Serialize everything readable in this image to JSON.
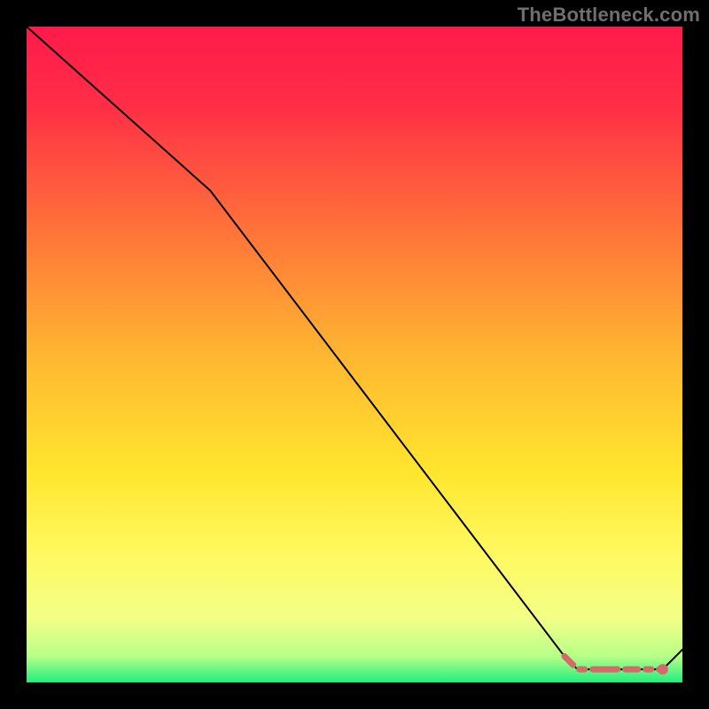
{
  "attribution": "TheBottleneck.com",
  "chart_data": {
    "type": "line",
    "title": "",
    "xlabel": "",
    "ylabel": "",
    "xlim": [
      0,
      100
    ],
    "ylim": [
      0,
      100
    ],
    "gradient_stops": [
      {
        "offset": 0,
        "color": "#ff1a4b"
      },
      {
        "offset": 12,
        "color": "#ff2e46"
      },
      {
        "offset": 30,
        "color": "#ff6f3a"
      },
      {
        "offset": 50,
        "color": "#ffb631"
      },
      {
        "offset": 68,
        "color": "#ffe62e"
      },
      {
        "offset": 80,
        "color": "#fff95f"
      },
      {
        "offset": 90,
        "color": "#f3ff86"
      },
      {
        "offset": 96,
        "color": "#b8ff88"
      },
      {
        "offset": 100,
        "color": "#1fef7f"
      }
    ],
    "series": [
      {
        "name": "bottleneck-curve",
        "x": [
          0,
          28,
          82,
          84,
          95,
          97,
          100
        ],
        "values": [
          100,
          75,
          4,
          2,
          2,
          2,
          5
        ],
        "color": "#000000",
        "width": 2
      }
    ],
    "dashed_segment": {
      "x": [
        82,
        84,
        95,
        97
      ],
      "values": [
        4,
        2,
        2,
        2
      ],
      "color": "#d46a6a",
      "width": 7
    },
    "marker": {
      "x": 97,
      "y": 2,
      "color": "#d46a6a",
      "radius": 6
    }
  }
}
